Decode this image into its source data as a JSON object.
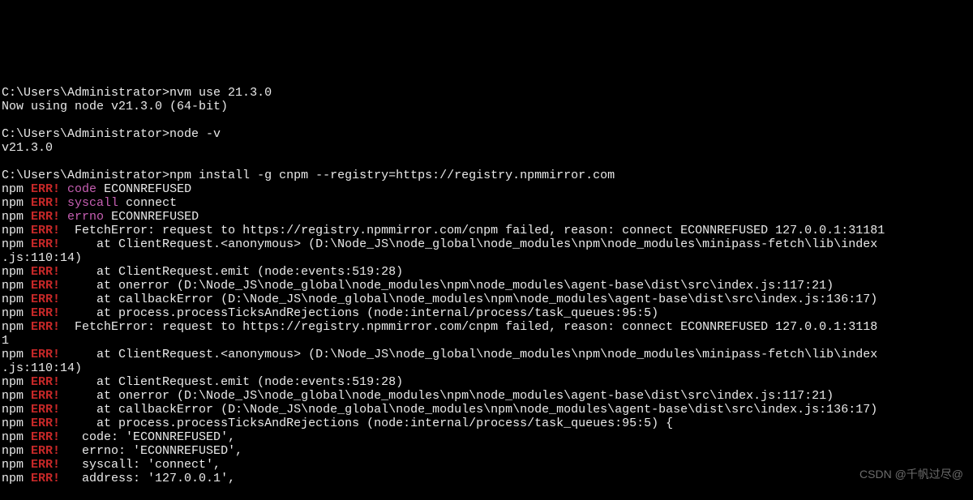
{
  "blank": "",
  "p1": {
    "dir": "C:\\Users\\Administrator>",
    "cmd": "nvm use 21.3.0"
  },
  "r1": "Now using node v21.3.0 (64-bit)",
  "p2": {
    "dir": "C:\\Users\\Administrator>",
    "cmd": "node -v"
  },
  "r2": "v21.3.0",
  "p3": {
    "dir": "C:\\Users\\Administrator>",
    "cmd": "npm install -g cnpm --registry=https://registry.npmmirror.com"
  },
  "npm": "npm ",
  "ERR": "ERR!",
  "sp": " ",
  "l1": {
    "k": "code",
    "v": " ECONNREFUSED"
  },
  "l2": {
    "k": "syscall",
    "v": " connect"
  },
  "l3": {
    "k": "errno",
    "v": " ECONNREFUSED"
  },
  "l4": "  FetchError: request to https://registry.npmmirror.com/cnpm failed, reason: connect ECONNREFUSED 127.0.0.1:31181",
  "l5a": "     at ClientRequest.<anonymous> (D:\\Node_JS\\node_global\\node_modules\\npm\\node_modules\\minipass-fetch\\lib\\index",
  "l5b": ".js:110:14)",
  "l6": "     at ClientRequest.emit (node:events:519:28)",
  "l7": "     at onerror (D:\\Node_JS\\node_global\\node_modules\\npm\\node_modules\\agent-base\\dist\\src\\index.js:117:21)",
  "l8": "     at callbackError (D:\\Node_JS\\node_global\\node_modules\\npm\\node_modules\\agent-base\\dist\\src\\index.js:136:17)",
  "l9": "     at process.processTicksAndRejections (node:internal/process/task_queues:95:5)",
  "l10a": "  FetchError: request to https://registry.npmmirror.com/cnpm failed, reason: connect ECONNREFUSED 127.0.0.1:3118",
  "l10b": "1",
  "l11b": "     at ClientRequest.<anonymous> (D:\\Node_JS\\node_global\\node_modules\\npm\\node_modules\\minipass-fetch\\lib\\index",
  "l11c": ".js:110:14)",
  "l12": "     at ClientRequest.emit (node:events:519:28)",
  "l13": "     at onerror (D:\\Node_JS\\node_global\\node_modules\\npm\\node_modules\\agent-base\\dist\\src\\index.js:117:21)",
  "l14": "     at callbackError (D:\\Node_JS\\node_global\\node_modules\\npm\\node_modules\\agent-base\\dist\\src\\index.js:136:17)",
  "l15": "     at process.processTicksAndRejections (node:internal/process/task_queues:95:5) {",
  "l16": "   code: 'ECONNREFUSED',",
  "l17": "   errno: 'ECONNREFUSED',",
  "l18": "   syscall: 'connect',",
  "l19": "   address: '127.0.0.1',",
  "watermark": "CSDN @千帆过尽@"
}
